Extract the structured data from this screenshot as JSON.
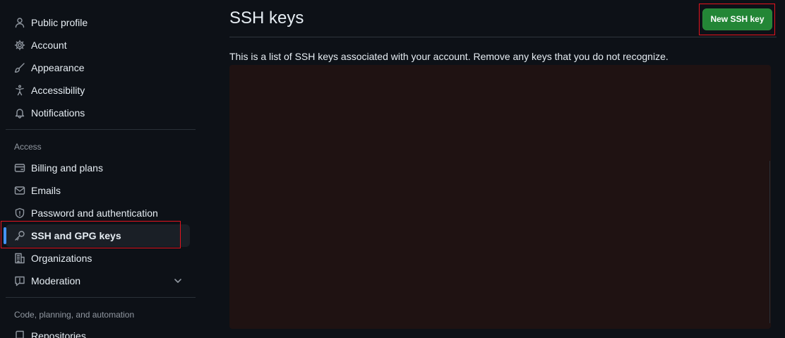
{
  "sidebar": {
    "top_items": [
      {
        "label": "Public profile",
        "icon": "person-icon"
      },
      {
        "label": "Account",
        "icon": "gear-icon"
      },
      {
        "label": "Appearance",
        "icon": "paintbrush-icon"
      },
      {
        "label": "Accessibility",
        "icon": "accessibility-icon"
      },
      {
        "label": "Notifications",
        "icon": "bell-icon"
      }
    ],
    "access_heading": "Access",
    "access_items": [
      {
        "label": "Billing and plans",
        "icon": "credit-card-icon"
      },
      {
        "label": "Emails",
        "icon": "mail-icon"
      },
      {
        "label": "Password and authentication",
        "icon": "shield-icon"
      },
      {
        "label": "SSH and GPG keys",
        "icon": "key-icon",
        "active": true
      },
      {
        "label": "Organizations",
        "icon": "organization-icon"
      },
      {
        "label": "Moderation",
        "icon": "report-icon",
        "expandable": true
      }
    ],
    "code_heading": "Code, planning, and automation",
    "code_items": [
      {
        "label": "Repositories",
        "icon": "repo-icon"
      }
    ]
  },
  "main": {
    "title": "SSH keys",
    "new_key_button": "New SSH key",
    "description": "This is a list of SSH keys associated with your account. Remove any keys that you do not recognize."
  },
  "colors": {
    "background": "#0d1117",
    "primary_button": "#238636",
    "active_indicator": "#4493f8",
    "highlight_box": "#e5131d",
    "redacted_panel": "#1f1212"
  }
}
